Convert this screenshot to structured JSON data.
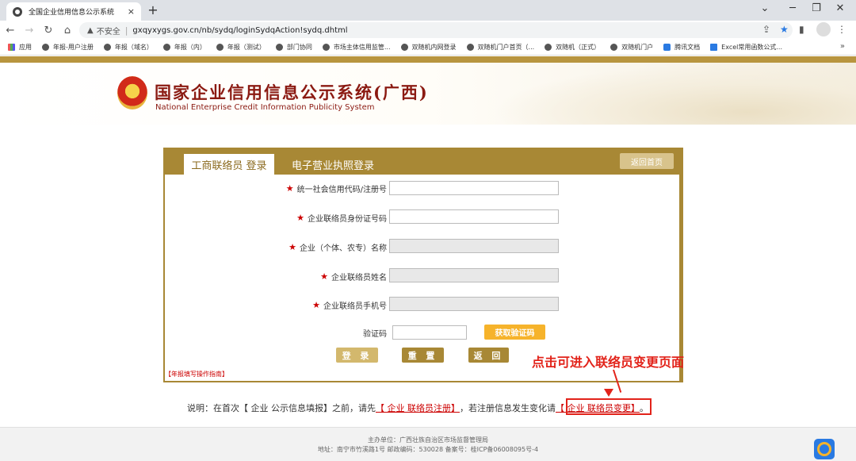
{
  "browser": {
    "tab_title": "全国企业信用信息公示系统",
    "tab_close": "×",
    "new_tab": "+",
    "url_insecure": "不安全",
    "url": "gxqyxygs.gov.cn/nb/sydq/loginSydqAction!sydq.dhtml",
    "win_min": "─",
    "win_max": "❐",
    "win_close": "✕",
    "win_menu": "⌄",
    "bookmarks": [
      "应用",
      "年报-用户注册",
      "年报（域名）",
      "年报（内）",
      "年报（测试）",
      "部门协同",
      "市场主体信用监管...",
      "双随机内网登录",
      "双随机门户首页（...",
      "双随机（正式）",
      "双随机门户",
      "腾讯文档",
      "Excel常用函数公式..."
    ],
    "bookmarks_more": "»"
  },
  "header": {
    "title": "国家企业信用信息公示系统(广西)",
    "subtitle": "National Enterprise Credit Information Publicity System"
  },
  "panel": {
    "tab_active": "工商联络员 登录",
    "tab_inactive": "电子营业执照登录",
    "back_home": "返回首页",
    "required_mark": "★",
    "fields": {
      "credit_code": "统一社会信用代码/注册号",
      "id_number": "企业联络员身份证号码",
      "company_name": "企业（个体、农专）名称",
      "contact_name": "企业联络员姓名",
      "contact_phone": "企业联络员手机号",
      "captcha": "验证码"
    },
    "sms_button": "获取验证码",
    "login_button": "登 录",
    "reset_button": "重 置",
    "return_button": "返 回",
    "guide_link": "【年报填写操作指南】"
  },
  "annotation": {
    "text": "点击可进入联络员变更页面"
  },
  "note": {
    "prefix": "说明：在首次【 企业 公示信息填报】之前，请先",
    "register_link": "【 企业 联络员注册】",
    "middle": "，若注册信息发生变化请",
    "change_link": "【 企业 联络员变更】",
    "suffix": "。"
  },
  "footer": {
    "line1": "主办单位：广西壮族自治区市场监督管理局",
    "line2": "地址：南宁市竹溪路1号 邮政编码：530028   备案号：桂ICP备06008095号-4"
  }
}
